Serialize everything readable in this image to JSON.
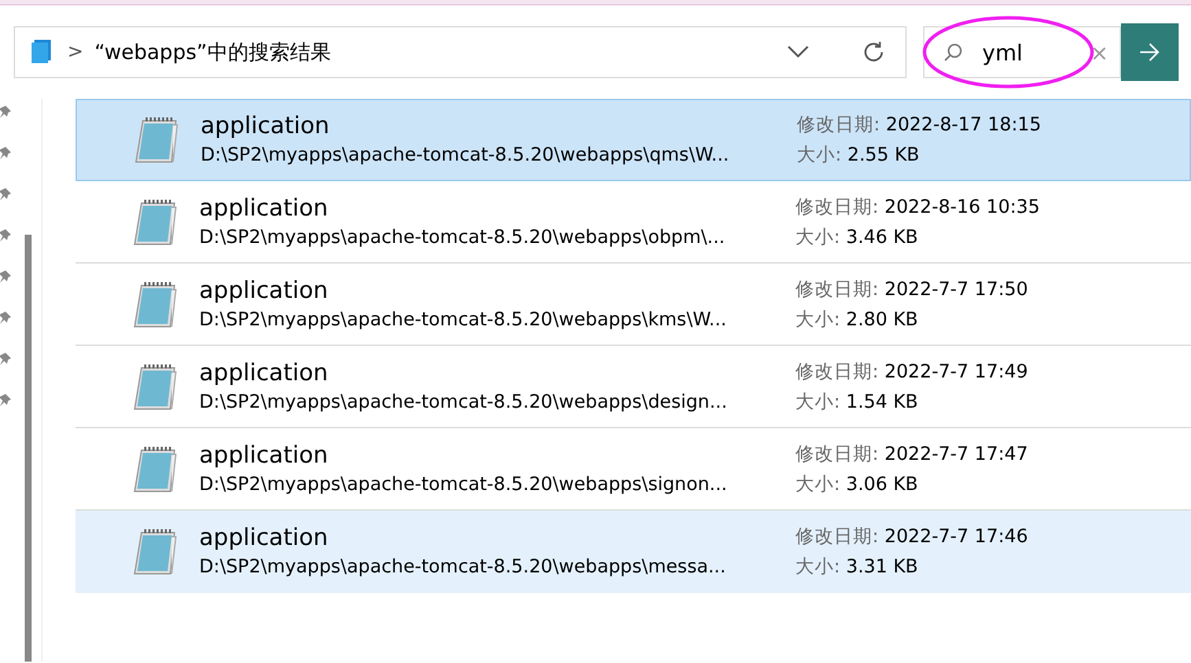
{
  "address_bar": {
    "separator": ">",
    "location": "“webapps”中的搜索结果"
  },
  "search": {
    "value": "yml",
    "clear": "×"
  },
  "results": [
    {
      "name": "application",
      "path": "D:\\SP2\\myapps\\apache-tomcat-8.5.20\\webapps\\qms\\W...",
      "date_label": "修改日期:",
      "date": "2022-8-17 18:15",
      "size_label": "大小:",
      "size": "2.55 KB",
      "selected": true,
      "hovered": false
    },
    {
      "name": "application",
      "path": "D:\\SP2\\myapps\\apache-tomcat-8.5.20\\webapps\\obpm\\...",
      "date_label": "修改日期:",
      "date": "2022-8-16 10:35",
      "size_label": "大小:",
      "size": "3.46 KB",
      "selected": false,
      "hovered": false
    },
    {
      "name": "application",
      "path": "D:\\SP2\\myapps\\apache-tomcat-8.5.20\\webapps\\kms\\W...",
      "date_label": "修改日期:",
      "date": "2022-7-7 17:50",
      "size_label": "大小:",
      "size": "2.80 KB",
      "selected": false,
      "hovered": false
    },
    {
      "name": "application",
      "path": "D:\\SP2\\myapps\\apache-tomcat-8.5.20\\webapps\\design...",
      "date_label": "修改日期:",
      "date": "2022-7-7 17:49",
      "size_label": "大小:",
      "size": "1.54 KB",
      "selected": false,
      "hovered": false
    },
    {
      "name": "application",
      "path": "D:\\SP2\\myapps\\apache-tomcat-8.5.20\\webapps\\signon...",
      "date_label": "修改日期:",
      "date": "2022-7-7 17:47",
      "size_label": "大小:",
      "size": "3.06 KB",
      "selected": false,
      "hovered": false
    },
    {
      "name": "application",
      "path": "D:\\SP2\\myapps\\apache-tomcat-8.5.20\\webapps\\messa...",
      "date_label": "修改日期:",
      "date": "2022-7-7 17:46",
      "size_label": "大小:",
      "size": "3.31 KB",
      "selected": false,
      "hovered": true
    }
  ]
}
